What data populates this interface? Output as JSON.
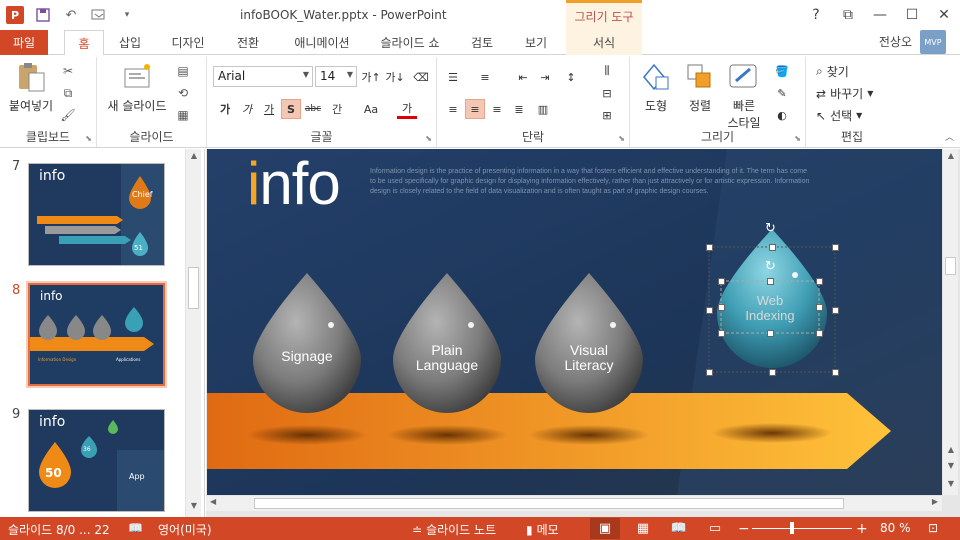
{
  "window": {
    "title": "infoBOOK_Water.pptx - PowerPoint",
    "context_tool": "그리기 도구",
    "help": "?",
    "user": "전상오",
    "avatar_text": "MVP"
  },
  "tabs": [
    {
      "label": "파일"
    },
    {
      "label": "홈"
    },
    {
      "label": "삽입"
    },
    {
      "label": "디자인"
    },
    {
      "label": "전환"
    },
    {
      "label": "애니메이션"
    },
    {
      "label": "슬라이드 쇼"
    },
    {
      "label": "검토"
    },
    {
      "label": "보기"
    },
    {
      "label": "서식"
    }
  ],
  "ribbon": {
    "clipboard": {
      "label": "클립보드",
      "paste": "붙여넣기"
    },
    "slides": {
      "label": "슬라이드",
      "new_slide": "새 슬라이드"
    },
    "font": {
      "label": "글꼴",
      "font_name": "Arial",
      "font_size": "14",
      "bold": "가",
      "italic": "가",
      "underline": "가",
      "shadow": "S",
      "strike": "abc",
      "spacing": "간",
      "case": "Aa",
      "color": "가"
    },
    "paragraph": {
      "label": "단락"
    },
    "drawing": {
      "label": "그리기",
      "shapes": "도형",
      "arrange": "정렬",
      "quick_styles_1": "빠른",
      "quick_styles_2": "스타일"
    },
    "editing": {
      "label": "편집",
      "find": "찾기",
      "replace": "바꾸기",
      "select": "선택"
    }
  },
  "thumbnails": [
    {
      "num": "7",
      "title": "info",
      "badge": "Chief",
      "value": "51"
    },
    {
      "num": "8",
      "title": "info",
      "left": "Information Design",
      "right": "Applications"
    },
    {
      "num": "9",
      "title": "info",
      "value": "50",
      "value2": "36",
      "app": "App"
    }
  ],
  "slide": {
    "title": "info",
    "description": "Information design is the practice of presenting information in a way that fosters efficient and effective understanding of it. The term has come to be used specifically for graphic design for displaying information effectively, rather than just attractively or for artistic expression. Information design is closely related to the field of data visualization and is often taught as part of graphic design courses.",
    "drops": [
      {
        "line1": "Signage",
        "line2": ""
      },
      {
        "line1": "Plain",
        "line2": "Language"
      },
      {
        "line1": "Visual",
        "line2": "Literacy"
      },
      {
        "line1": "Web",
        "line2": "Indexing"
      }
    ]
  },
  "status": {
    "slide_info": "슬라이드 8/0 ... 22",
    "language": "영어(미국)",
    "notes": "슬라이드 노트",
    "comments": "메모",
    "zoom": "80 %",
    "zoom_value": 80
  },
  "colors": {
    "accent": "#d24726",
    "slide_bg": "#1f3c62",
    "arrow": "#f08a16",
    "drop_gray": "#8a8a8a",
    "drop_teal": "#3aa0b5"
  }
}
